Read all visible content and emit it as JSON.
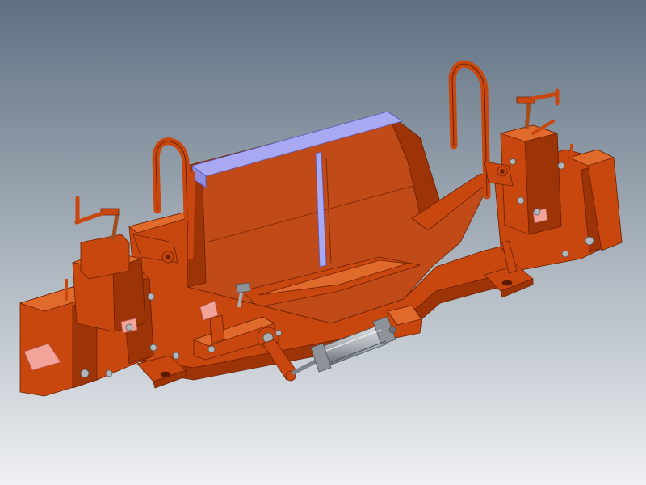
{
  "viewport": {
    "background_top": "#5f7081",
    "background_bottom": "#eef0f3",
    "model": {
      "name": "welding-fixture-assembly",
      "frame_color": "#c8470f",
      "frame_shadow": "#9c3408",
      "frame_highlight": "#e06a2c",
      "edge_color": "#6a2000",
      "plate_color": "#c04a18",
      "blue_strip_color": "#a9a8f2",
      "pink_pad_color": "#f2a39a",
      "steel_color": "#a8aeb4",
      "steel_dark": "#4e545a"
    }
  }
}
